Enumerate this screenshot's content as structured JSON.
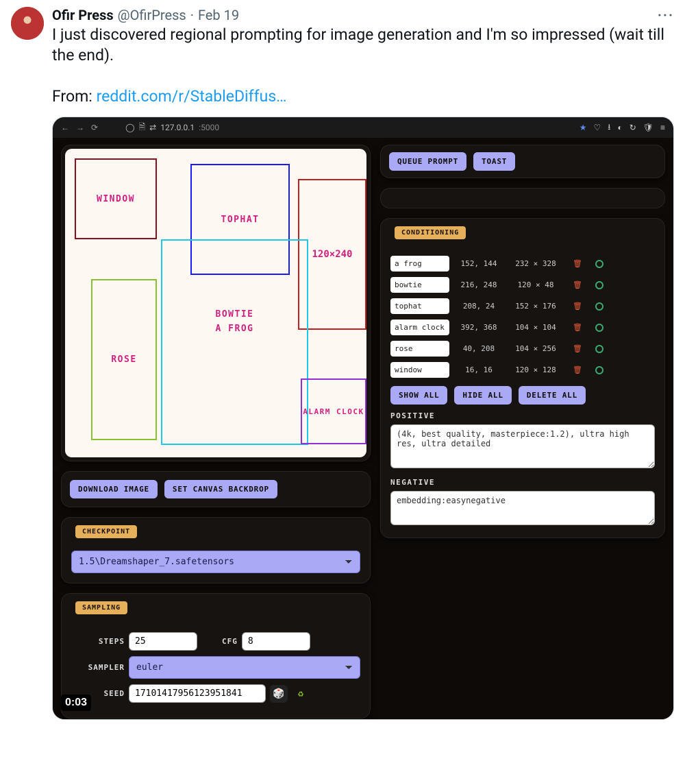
{
  "tweet": {
    "display_name": "Ofir Press",
    "handle": "@OfirPress",
    "sep": "·",
    "date": "Feb 19",
    "body_line1": "I just discovered regional prompting for image generation and I'm so impressed (wait till the end).",
    "body_from_prefix": "From: ",
    "body_link": "reddit.com/r/StableDiffus…",
    "more": "···",
    "video_timestamp": "0:03"
  },
  "browser": {
    "url_host": "127.0.0.1",
    "url_port": ":5000"
  },
  "app": {
    "buttons": {
      "queue_prompt": "QUEUE PROMPT",
      "toast": "TOAST",
      "download_image": "DOWNLOAD IMAGE",
      "set_canvas_backdrop": "SET CANVAS BACKDROP",
      "show_all": "SHOW ALL",
      "hide_all": "HIDE ALL",
      "delete_all": "DELETE ALL"
    },
    "sections": {
      "checkpoint": "CHECKPOINT",
      "sampling": "SAMPLING",
      "conditioning": "CONDITIONING"
    },
    "checkpoint": {
      "value": "1.5\\Dreamshaper_7.safetensors"
    },
    "sampling": {
      "steps_label": "STEPS",
      "steps": "25",
      "cfg_label": "CFG",
      "cfg": "8",
      "sampler_label": "SAMPLER",
      "sampler": "euler",
      "seed_label": "SEED",
      "seed": "17101417956123951841"
    },
    "canvas": {
      "regions": {
        "window": "WINDOW",
        "tophat": "TOPHAT",
        "dim": "120×240",
        "bowtie": "BOWTIE",
        "afrog": "A FROG",
        "rose": "ROSE",
        "alarm": "ALARM CLOCK"
      }
    },
    "conditioning": {
      "rows": [
        {
          "name": "a frog",
          "pos": "152, 144",
          "size": "232 × 328"
        },
        {
          "name": "bowtie",
          "pos": "216, 248",
          "size": "120 × 48"
        },
        {
          "name": "tophat",
          "pos": "208, 24",
          "size": "152 × 176"
        },
        {
          "name": "alarm clock",
          "pos": "392, 368",
          "size": "104 × 104"
        },
        {
          "name": "rose",
          "pos": "40, 208",
          "size": "104 × 256"
        },
        {
          "name": "window",
          "pos": "16, 16",
          "size": "120 × 128"
        }
      ],
      "positive_label": "POSITIVE",
      "positive": "(4k, best quality, masterpiece:1.2), ultra high res, ultra detailed",
      "negative_label": "NEGATIVE",
      "negative": "embedding:easynegative"
    }
  }
}
